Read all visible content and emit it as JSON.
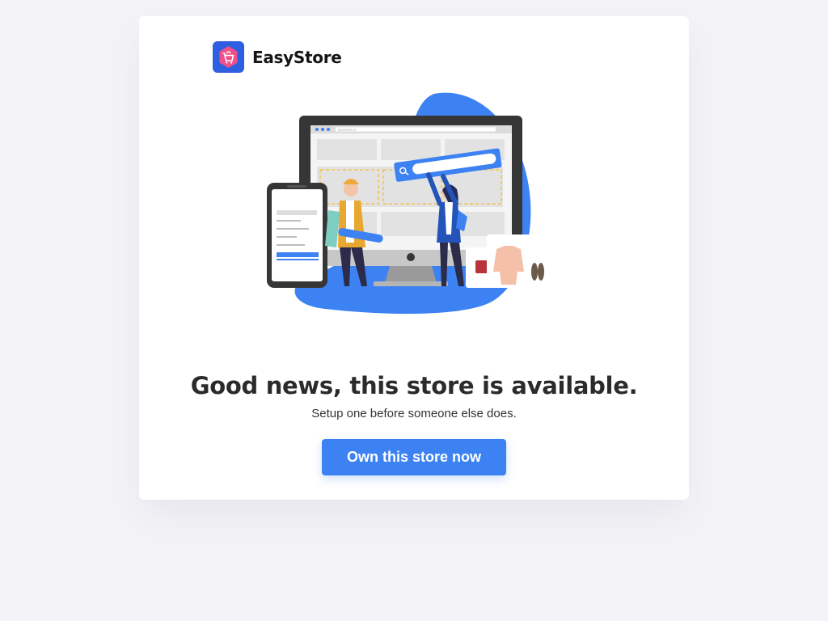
{
  "brand": {
    "name": "EasyStore",
    "logo_icon": "shopping-bag-icon",
    "logo_color": "#2e5fe0",
    "logo_accent": "#f0508a"
  },
  "illustration": {
    "description_icon": "online-store-illustration",
    "url_bar_text": "easystore.co"
  },
  "main": {
    "headline": "Good news, this store is available.",
    "subline": "Setup one before someone else does.",
    "cta_label": "Own this store now"
  },
  "colors": {
    "accent": "#3d82f2",
    "background": "#f4f4f8",
    "card": "#ffffff",
    "text": "#2b2b2b"
  }
}
